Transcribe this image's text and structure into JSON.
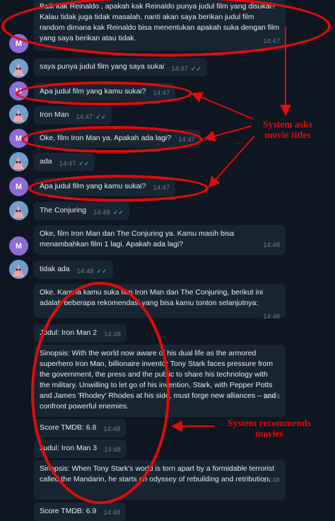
{
  "messages": [
    {
      "sender": "bot",
      "text": "Baik kak Reinaldo , apakah kak Reinaldo punya judul film yang disukai? Kalau tidak juga tidak masalah, nanti akan saya berikan judul film random dimana kak Reinaldo bisa menentukan apakah suka dengan film yang saya berikan atau tidak.",
      "time": "14:47",
      "read": false
    },
    {
      "sender": "user",
      "text": "saya punya judul film yang saya sukai",
      "time": "14:47",
      "read": true
    },
    {
      "sender": "bot",
      "text": "Apa judul film yang kamu sukai?",
      "time": "14:47",
      "read": false
    },
    {
      "sender": "user",
      "text": "Iron Man",
      "time": "14:47",
      "read": true
    },
    {
      "sender": "bot",
      "text": "Oke, film Iron Man ya. Apakah ada lagi?",
      "time": "14:47",
      "read": false
    },
    {
      "sender": "user",
      "text": "ada",
      "time": "14:47",
      "read": true
    },
    {
      "sender": "bot",
      "text": "Apa judul film yang kamu sukai?",
      "time": "14:47",
      "read": false
    },
    {
      "sender": "user",
      "text": "The Conjuring",
      "time": "14:48",
      "read": true
    },
    {
      "sender": "bot",
      "text": "Oke, film Iron Man dan The Conjuring ya. Kamu masih bisa menambahkan film 1 lagi. Apakah ada lagi?",
      "time": "14:48",
      "read": false
    },
    {
      "sender": "user",
      "text": "tidak ada",
      "time": "14:48",
      "read": true
    },
    {
      "sender": "bot",
      "text": "Oke. Karena kamu suka film Iron Man dan The Conjuring, berikut ini adalah beberapa rekomendasi yang bisa kamu tonton selanjutnya:",
      "time": "14:48",
      "read": false
    },
    {
      "sender": "bot",
      "text": "Judul: Iron Man 2",
      "time": "14:48",
      "read": false
    },
    {
      "sender": "bot",
      "text": "Sinopsis: With the world now aware of his dual life as the armored superhero Iron Man, billionaire inventor Tony Stark faces pressure from the government, the press and the public to share his technology with the military. Unwilling to let go of his invention, Stark, with Pepper Potts and James 'Rhodey' Rhodes at his side, must forge new alliances – and confront powerful enemies.",
      "time": "14:48",
      "read": false
    },
    {
      "sender": "bot",
      "text": "Score TMDB: 6.8",
      "time": "14:48",
      "read": false
    },
    {
      "sender": "bot",
      "text": "Judul: Iron Man 3",
      "time": "14:48",
      "read": false
    },
    {
      "sender": "bot",
      "text": "Sinopsis: When Tony Stark's world is torn apart by a formidable terrorist called the Mandarin, he starts an odyssey of rebuilding and retribution.",
      "time": "14:48",
      "read": false
    },
    {
      "sender": "bot",
      "text": "Score TMDB: 6.9",
      "time": "14:48",
      "read": false
    }
  ],
  "avatar_letter": "M",
  "annotations": {
    "asks_label": "System asks movie titles",
    "recommends_label": "System recommends movies"
  },
  "colors": {
    "annotation": "#e30b0b",
    "bubble": "#182533",
    "background": "#0e1621",
    "check": "#5fb4e8"
  }
}
